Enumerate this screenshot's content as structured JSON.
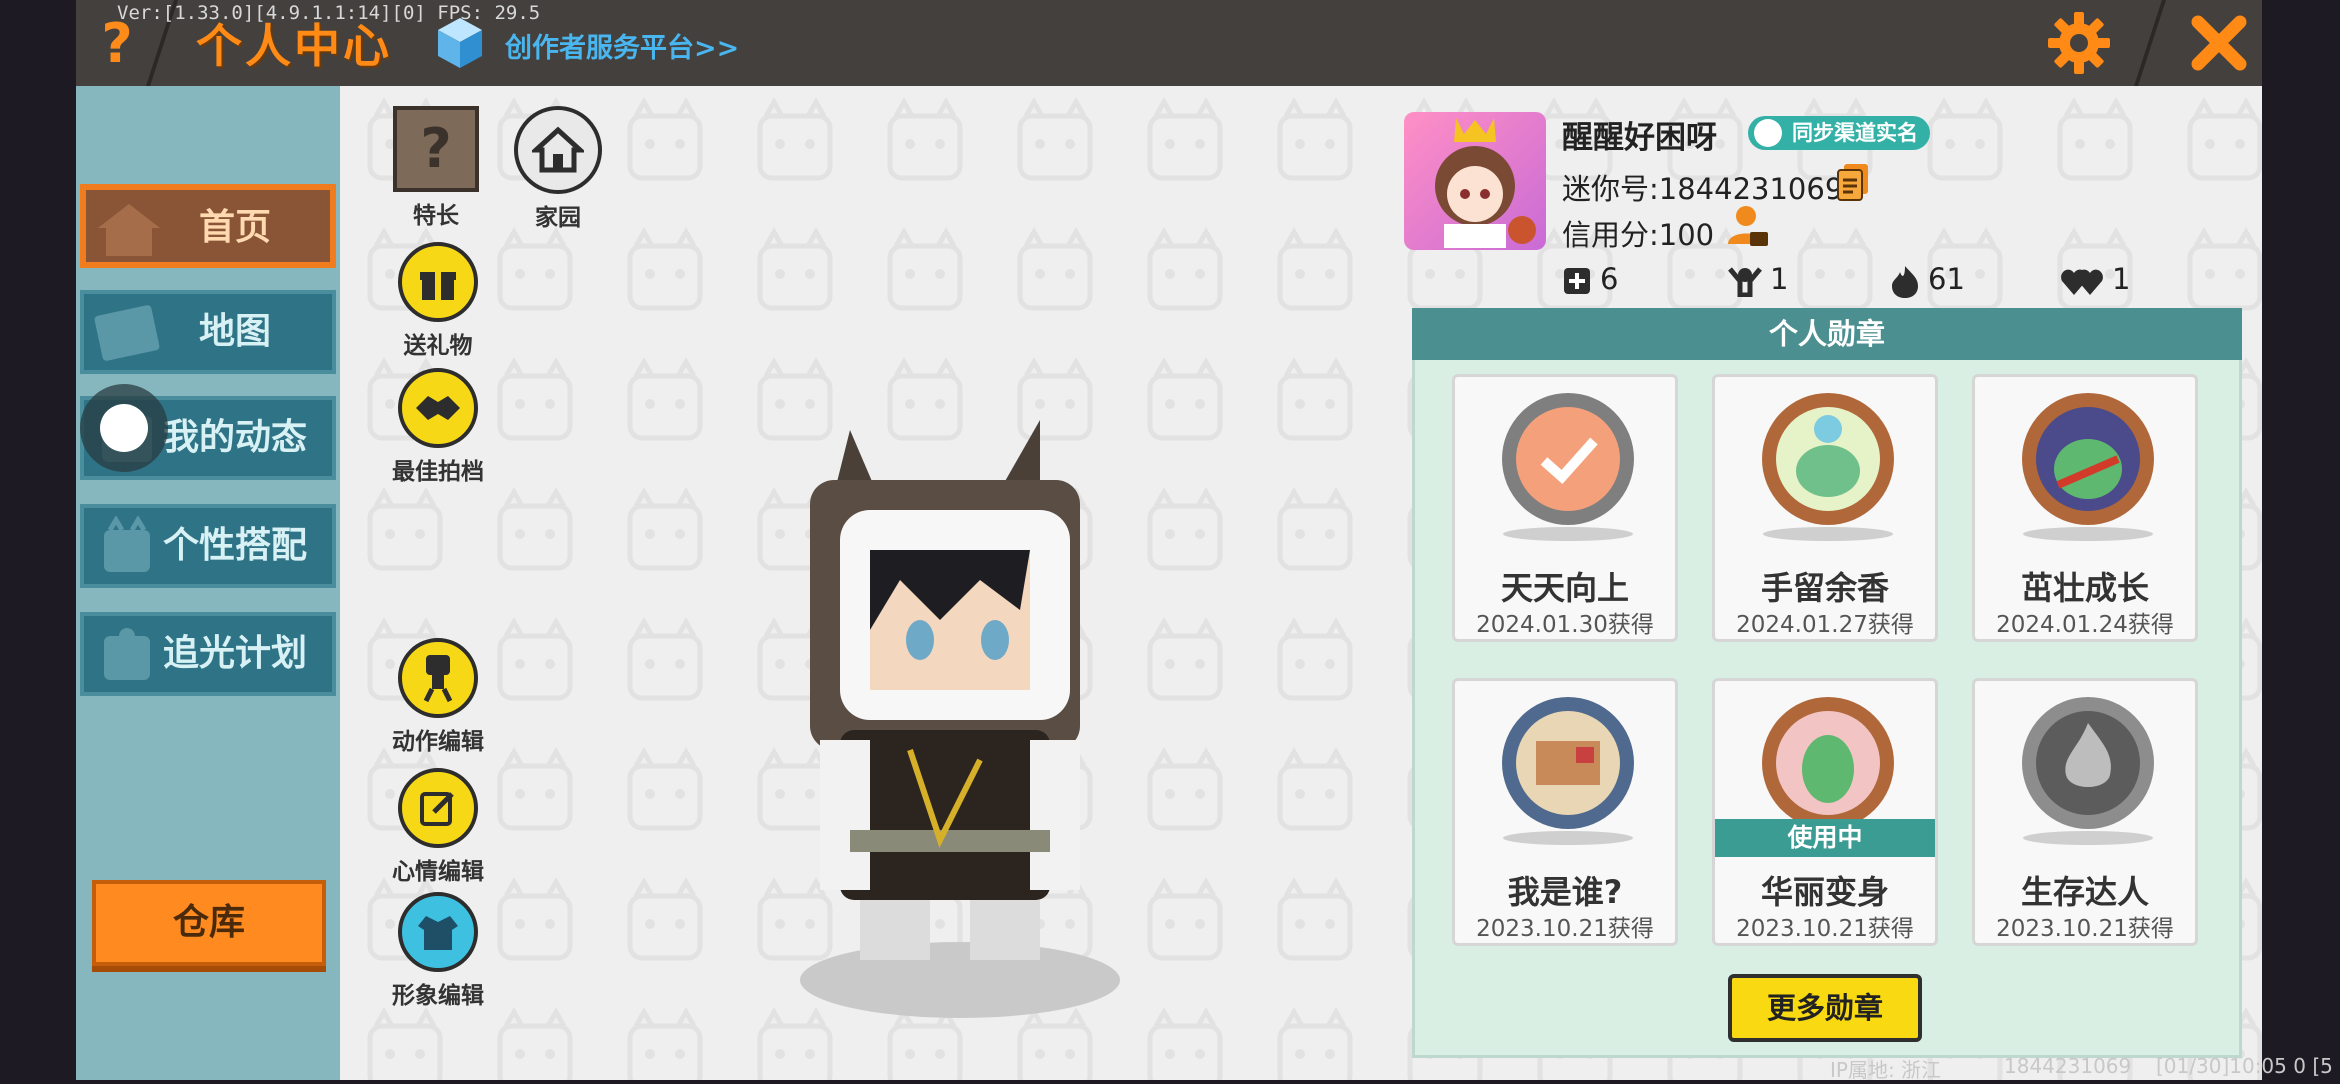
{
  "debug": {
    "version_line": "Ver:[1.33.0][4.9.1.1:14][0] FPS: 29.5"
  },
  "header": {
    "title": "个人中心",
    "creator_link": "创作者服务平台>>"
  },
  "sidebar": {
    "items": [
      {
        "label": "首页",
        "icon": "house-icon",
        "active": true
      },
      {
        "label": "地图",
        "icon": "map-icon",
        "active": false
      },
      {
        "label": "我的动态",
        "icon": "feed-icon",
        "active": false
      },
      {
        "label": "个性搭配",
        "icon": "outfit-icon",
        "active": false
      },
      {
        "label": "追光计划",
        "icon": "light-icon",
        "active": false
      }
    ],
    "warehouse_label": "仓库"
  },
  "actions": {
    "specialty": "特长",
    "home": "家园",
    "send_gift": "送礼物",
    "best_shot": "最佳拍档",
    "action_edit": "动作编辑",
    "mood_edit": "心情编辑",
    "look_edit": "形象编辑"
  },
  "profile": {
    "username": "醒醒好困呀",
    "sync_badge": "同步渠道实名",
    "mini_id": "迷你号:1844231069",
    "credit": "信用分:100",
    "stats": {
      "friends": "6",
      "followers": "1",
      "heat": "61",
      "likes": "1"
    }
  },
  "medals": {
    "header": "个人勋章",
    "items": [
      {
        "name": "天天向上",
        "date": "2024.01.30获得",
        "in_use": false
      },
      {
        "name": "手留余香",
        "date": "2024.01.27获得",
        "in_use": false
      },
      {
        "name": "茁壮成长",
        "date": "2024.01.24获得",
        "in_use": false
      },
      {
        "name": "我是谁?",
        "date": "2023.10.21获得",
        "in_use": false
      },
      {
        "name": "华丽变身",
        "date": "2023.10.21获得",
        "in_use": true,
        "in_use_label": "使用中"
      },
      {
        "name": "生存达人",
        "date": "2023.10.21获得",
        "in_use": false
      }
    ],
    "more_label": "更多勋章"
  },
  "footer": {
    "ip_location": "IP属地: 浙江",
    "uid": "1844231069",
    "timestamp": "[01/30]10:05 0 [5"
  },
  "colors": {
    "accent_orange": "#ff8a16",
    "teal": "#4c8f90",
    "yellow": "#f8d912",
    "sidebar": "#86b7bf"
  }
}
